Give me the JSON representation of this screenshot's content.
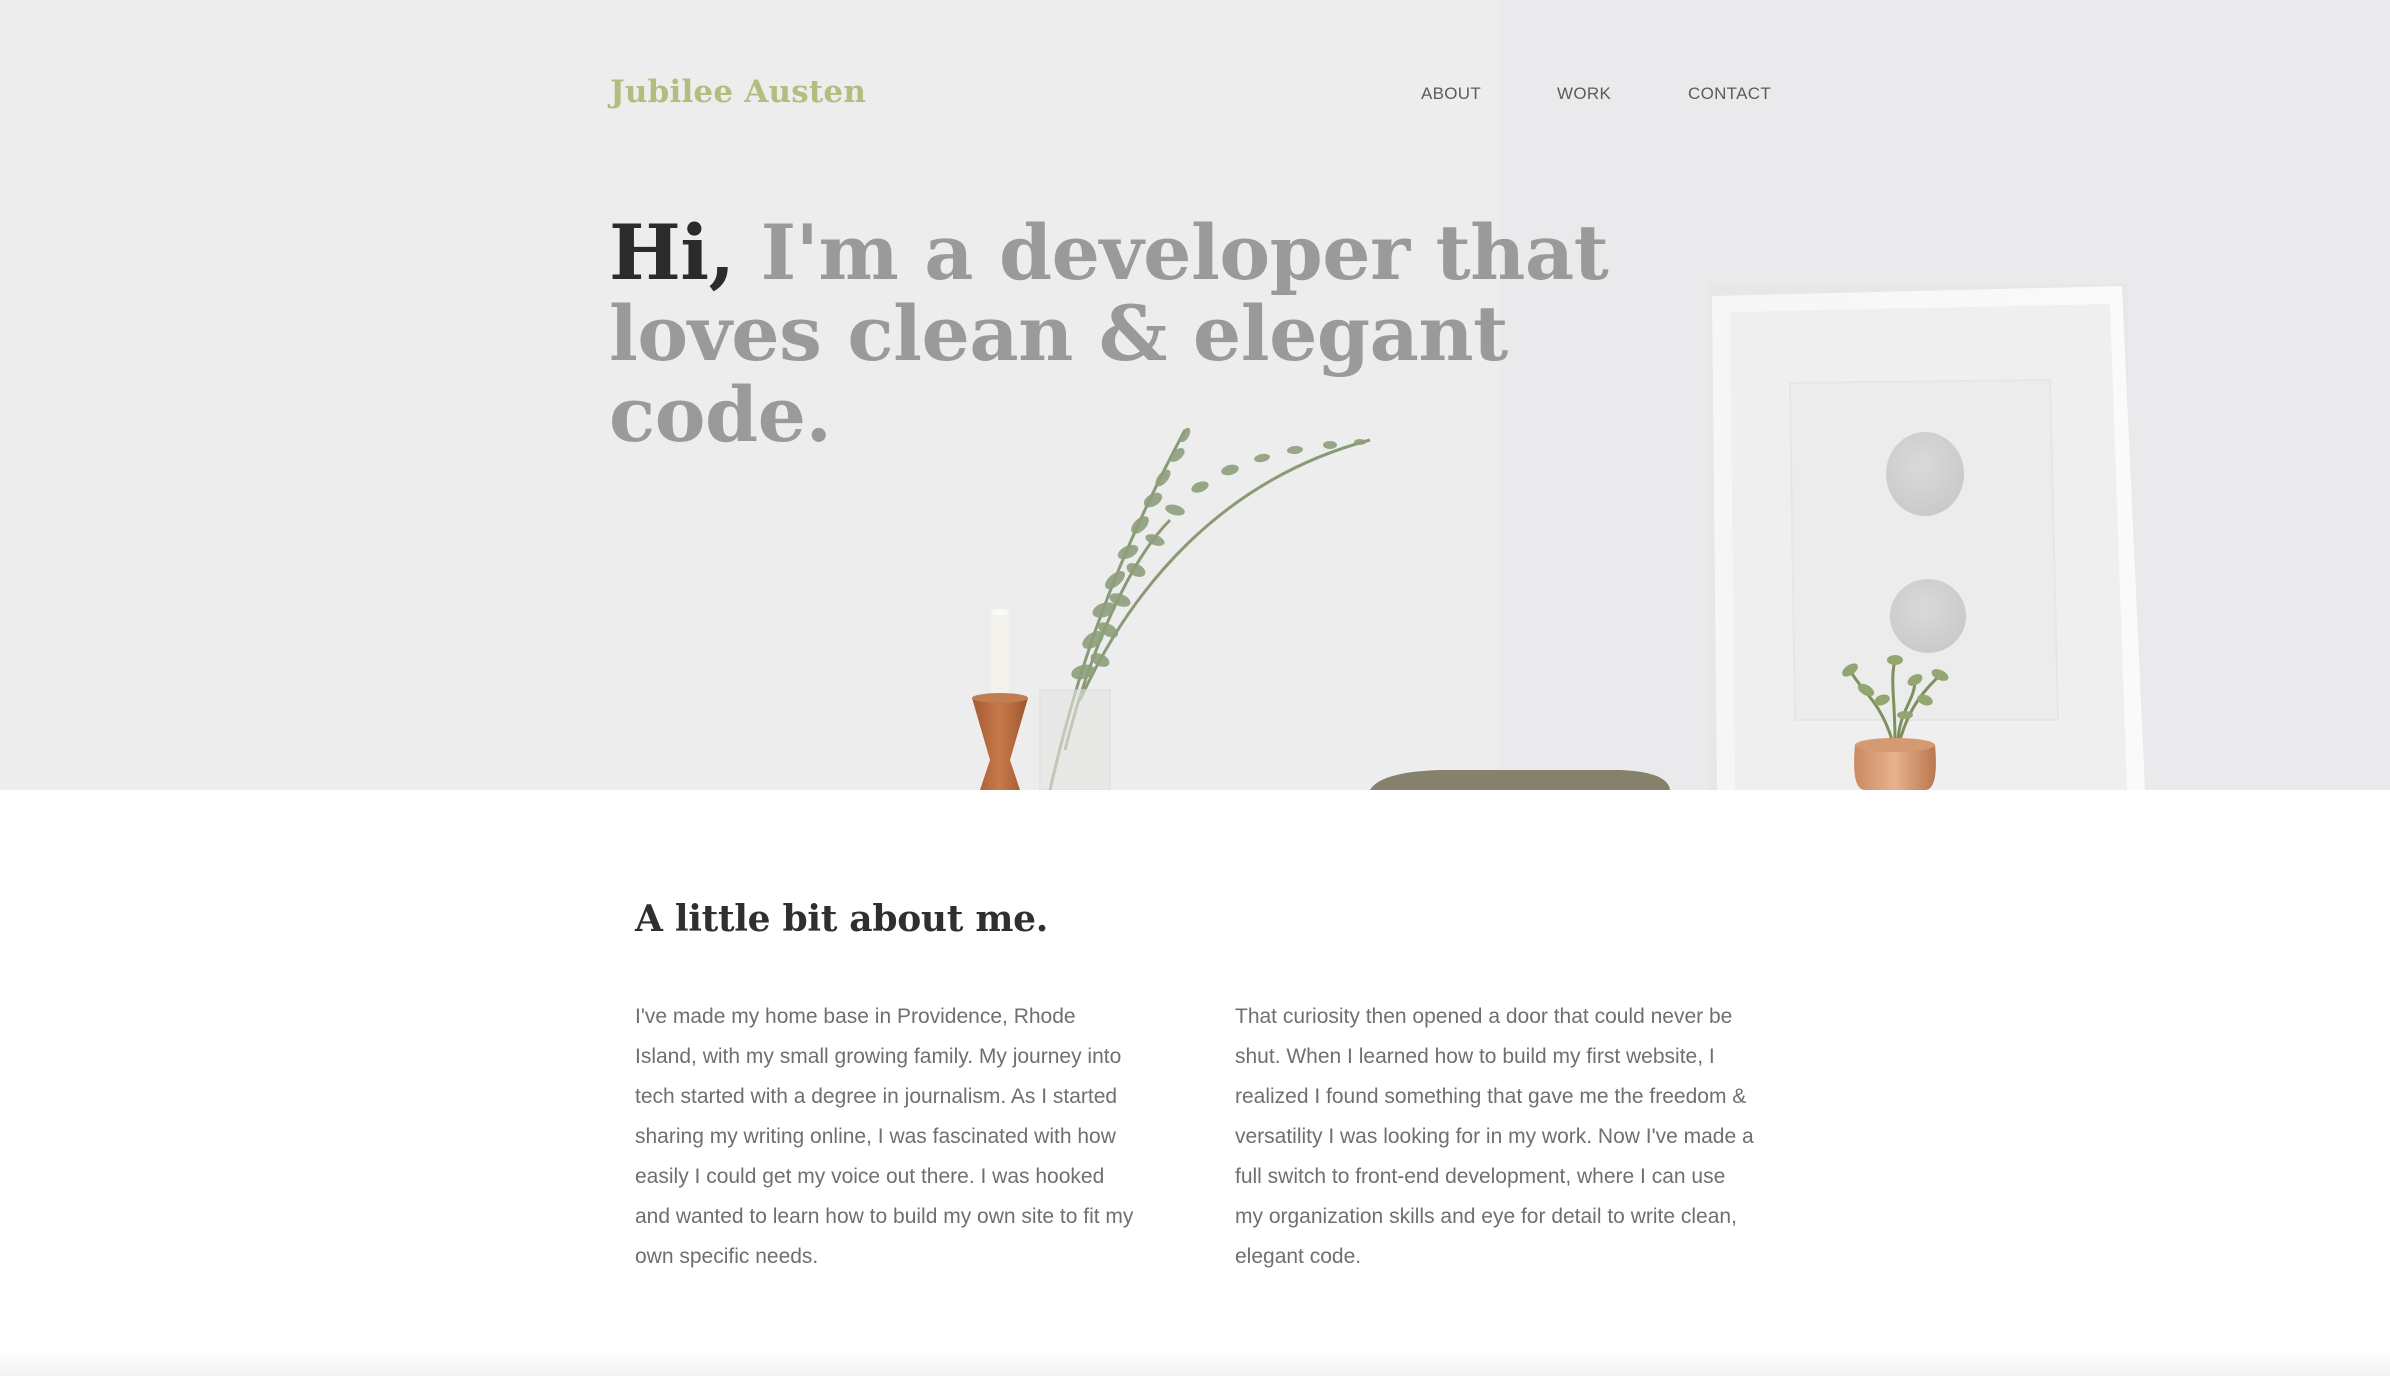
{
  "header": {
    "brand": "Jubilee Austen",
    "nav": [
      "ABOUT",
      "WORK",
      "CONTACT"
    ]
  },
  "hero": {
    "greeting": "Hi,",
    "headline_rest": "I'm a developer that loves clean & elegant code."
  },
  "about": {
    "title": "A little bit about me.",
    "paragraph_left": "I've made my home base in Providence, Rhode Island, with my small growing family. My journey into tech started with a degree in journalism. As I started sharing my writing online, I was fascinated with how easily I could get my voice out there. I was hooked and wanted to learn how to build my own site to fit my own specific needs.",
    "paragraph_right": "That curiosity then opened a door that could never be shut. When I learned how to build my first website, I realized I found something that gave me the freedom & versatility I was looking for in my work. Now I've made a full switch to front-end development, where I can use my organization skills and eye for detail to write clean, elegant code."
  },
  "colors": {
    "brand": "#b4bd7f",
    "headline_dark": "#2b2b2b",
    "headline_gray": "#9a9a9a",
    "body_text": "#6f6f6f"
  }
}
